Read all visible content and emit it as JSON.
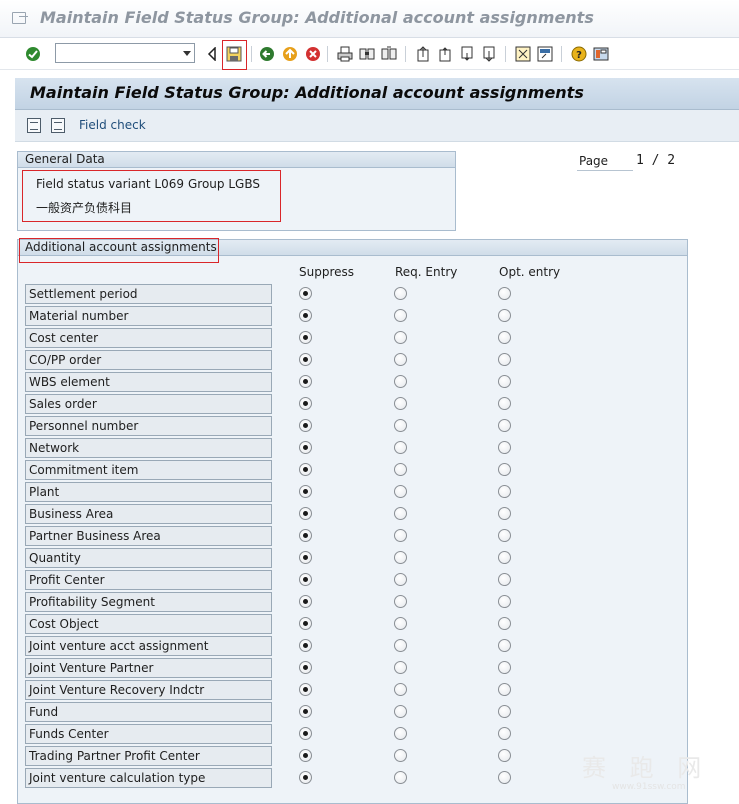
{
  "window": {
    "title": "Maintain Field Status Group: Additional account assignments"
  },
  "toolbar": {
    "command_field_value": "",
    "icons": [
      "enter-check-icon",
      "back-triangle-icon",
      "save-icon",
      "back-icon",
      "exit-icon",
      "cancel-icon",
      "print-icon",
      "find-icon",
      "find-next-icon",
      "first-page-icon",
      "previous-page-icon",
      "next-page-icon",
      "last-page-icon",
      "create-session-icon",
      "shortcut-icon",
      "help-icon",
      "layout-menu-icon"
    ],
    "colors": {
      "save_highlight": "#d9262a"
    }
  },
  "app": {
    "title": "Maintain Field Status Group: Additional account assignments",
    "tools": {
      "field_check_label": "Field check"
    }
  },
  "general_data": {
    "heading": "General Data",
    "variant_text": "Field status variant L069",
    "group_text": "Group LGBS",
    "group_description": "一般资产负债科目"
  },
  "pagination": {
    "label": "Page",
    "value": "1 / 2"
  },
  "assignments": {
    "heading": "Additional account assignments",
    "columns": [
      "Suppress",
      "Req. Entry",
      "Opt. entry"
    ],
    "rows": [
      {
        "label": "Settlement period",
        "selected": "suppress"
      },
      {
        "label": "Material number",
        "selected": "suppress"
      },
      {
        "label": "Cost center",
        "selected": "suppress"
      },
      {
        "label": "CO/PP order",
        "selected": "suppress"
      },
      {
        "label": "WBS element",
        "selected": "suppress"
      },
      {
        "label": "Sales order",
        "selected": "suppress"
      },
      {
        "label": "Personnel number",
        "selected": "suppress"
      },
      {
        "label": "Network",
        "selected": "suppress"
      },
      {
        "label": "Commitment item",
        "selected": "suppress"
      },
      {
        "label": "Plant",
        "selected": "suppress"
      },
      {
        "label": "Business Area",
        "selected": "suppress"
      },
      {
        "label": "Partner Business Area",
        "selected": "suppress"
      },
      {
        "label": "Quantity",
        "selected": "suppress"
      },
      {
        "label": "Profit Center",
        "selected": "suppress"
      },
      {
        "label": "Profitability Segment",
        "selected": "suppress"
      },
      {
        "label": "Cost Object",
        "selected": "suppress"
      },
      {
        "label": "Joint venture acct assignment",
        "selected": "suppress"
      },
      {
        "label": "Joint Venture Partner",
        "selected": "suppress"
      },
      {
        "label": "Joint Venture Recovery Indctr",
        "selected": "suppress"
      },
      {
        "label": "Fund",
        "selected": "suppress"
      },
      {
        "label": "Funds Center",
        "selected": "suppress"
      },
      {
        "label": "Trading Partner Profit Center",
        "selected": "suppress"
      },
      {
        "label": "Joint venture calculation type",
        "selected": "suppress"
      }
    ]
  },
  "watermark": {
    "text": "赛 跑 网",
    "url": "www.91ssw.com"
  }
}
